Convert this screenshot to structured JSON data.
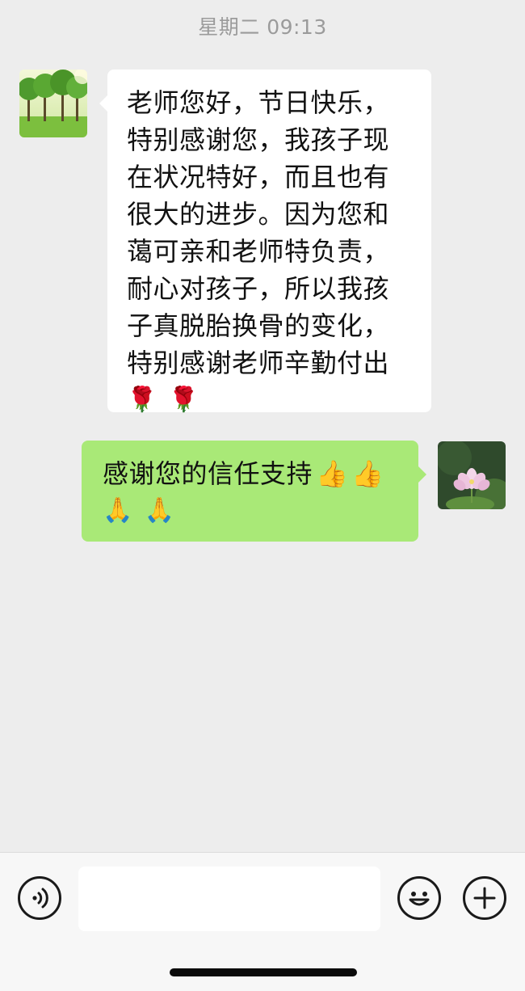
{
  "header": {
    "timestamp": "星期二 09:13"
  },
  "messages": [
    {
      "side": "incoming",
      "lines": [
        "老师您好，节日快乐，",
        "特别感谢您，我孩子现",
        "在状况特好，而且也有",
        "很大的进步。因为您和",
        "蔼可亲和老师特负责，",
        "耐心对孩子，所以我孩",
        "子真脱胎换骨的变化，",
        "特别感谢老师辛勤付出"
      ],
      "emoji": [
        "🌹",
        "🌹"
      ]
    },
    {
      "side": "outgoing",
      "text": "感谢您的信任支持",
      "inline_emoji": [
        "👍",
        "👍"
      ],
      "emoji": [
        "🙏",
        "🙏"
      ]
    }
  ],
  "input_bar": {
    "voice_icon": "voice-icon",
    "emoji_icon": "emoji-icon",
    "plus_icon": "plus-icon",
    "text_value": ""
  },
  "colors": {
    "background": "#ededed",
    "incoming_bubble": "#ffffff",
    "outgoing_bubble": "#a9e977",
    "timestamp": "#9b9b9b"
  }
}
